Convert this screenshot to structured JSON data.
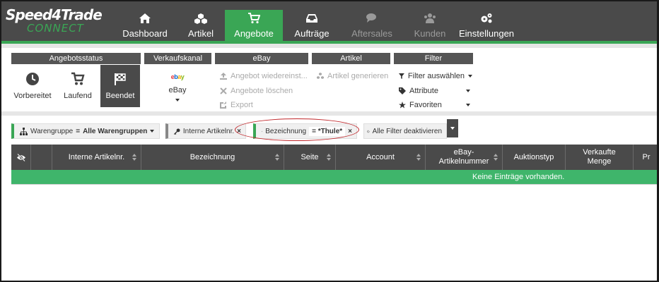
{
  "logo": {
    "top": "Speed4Trade",
    "bottom": "CONNECT"
  },
  "nav": [
    {
      "label": "Dashboard",
      "icon": "home-icon",
      "state": "normal"
    },
    {
      "label": "Artikel",
      "icon": "cubes-icon",
      "state": "normal"
    },
    {
      "label": "Angebote",
      "icon": "cart-icon",
      "state": "active"
    },
    {
      "label": "Aufträge",
      "icon": "inbox-icon",
      "state": "normal"
    },
    {
      "label": "Aftersales",
      "icon": "chat-icon",
      "state": "disabled"
    },
    {
      "label": "Kunden",
      "icon": "users-icon",
      "state": "disabled"
    },
    {
      "label": "Einstellungen",
      "icon": "gears-icon",
      "state": "normal"
    }
  ],
  "ribbon": {
    "angebotsstatus": {
      "title": "Angebotsstatus",
      "buttons": [
        {
          "label": "Vorbereitet",
          "icon": "clock-icon"
        },
        {
          "label": "Laufend",
          "icon": "cart-icon"
        },
        {
          "label": "Beendet",
          "icon": "checkered-flag-icon",
          "active": true
        }
      ]
    },
    "verkaufskanal": {
      "title": "Verkaufskanal",
      "channel": "eBay"
    },
    "ebay": {
      "title": "eBay",
      "actions": [
        {
          "label": "Angebot wiedereinst...",
          "icon": "upload-icon"
        },
        {
          "label": "Angebote löschen",
          "icon": "times-icon"
        },
        {
          "label": "Export",
          "icon": "export-icon"
        }
      ]
    },
    "artikel": {
      "title": "Artikel",
      "actions": [
        {
          "label": "Artikel generieren",
          "icon": "cubes-icon"
        }
      ]
    },
    "filter": {
      "title": "Filter",
      "actions": [
        {
          "label": "Filter auswählen",
          "icon": "filter-icon"
        },
        {
          "label": "Attribute",
          "icon": "tags-icon"
        },
        {
          "label": "Favoriten",
          "icon": "star-icon"
        }
      ]
    }
  },
  "filters": {
    "warengruppe": {
      "label": "Warengruppe",
      "op": "=",
      "value": "Alle Warengruppen"
    },
    "interne": {
      "label": "Interne Artikelnr.",
      "close": "×"
    },
    "bezeichnung": {
      "label": "Bezeichnung",
      "op": "=",
      "value": "*Thule*",
      "close": "×"
    },
    "deactivate": {
      "label": "Alle Filter deaktivieren"
    }
  },
  "table": {
    "columns": [
      "",
      "",
      "Interne Artikelnr.",
      "Bezeichnung",
      "Seite",
      "Account",
      "eBay-Artikelnummer",
      "Auktionstyp",
      "Verkaufte Menge",
      "Pr"
    ],
    "empty_message": "Keine Einträge vorhanden."
  }
}
